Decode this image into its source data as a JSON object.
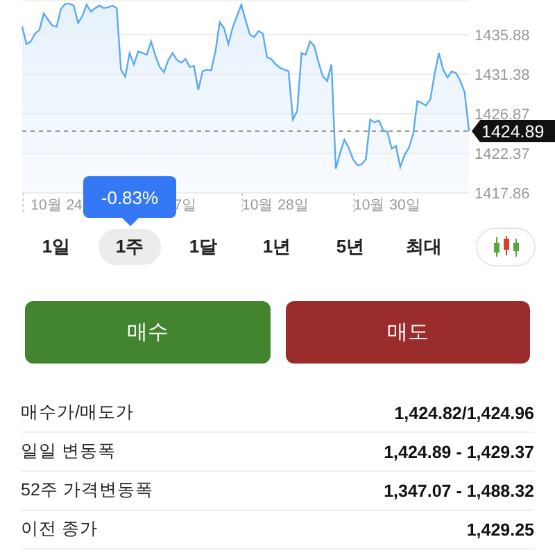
{
  "chart": {
    "chart_data": {
      "type": "area",
      "grid": true,
      "categories": [
        null,
        null,
        null,
        null,
        null,
        null,
        null,
        null,
        "10월 24",
        null,
        null,
        null,
        null,
        null,
        null,
        null,
        null,
        null,
        null,
        null,
        null,
        null,
        null,
        null,
        null,
        null,
        null,
        null,
        null,
        null,
        null,
        null,
        null,
        null,
        null,
        null,
        null,
        null,
        "7일",
        null,
        null,
        null,
        null,
        null,
        null,
        null,
        null,
        null,
        null,
        null,
        null,
        null,
        null,
        null,
        null,
        null,
        null,
        null,
        null,
        "10월 28일",
        null,
        null,
        null,
        null,
        null,
        null,
        null,
        null,
        null,
        null,
        null,
        null,
        null,
        null,
        null,
        null,
        null,
        null,
        null,
        null,
        null,
        null,
        null,
        null,
        null,
        "10월 30일",
        null,
        null,
        null,
        null,
        null,
        null,
        null,
        null,
        null,
        null,
        null,
        null,
        null,
        null,
        null,
        null,
        null,
        null,
        null
      ],
      "series": [
        {
          "color": "#5aa9f5",
          "values": [
            1436.8,
            1434.8,
            1435.1,
            1436.0,
            1436.4,
            1438.3,
            1437.6,
            1436.9,
            1436.8,
            1438.8,
            1439.4,
            1439.4,
            1439.2,
            1437.2,
            1438.0,
            1439.3,
            1438.5,
            1438.9,
            1439.2,
            1438.9,
            1439.0,
            1439.2,
            1438.9,
            1431.9,
            1431.1,
            1433.8,
            1432.5,
            1434.0,
            1433.8,
            1433.6,
            1435.1,
            1433.5,
            1432.2,
            1431.6,
            1433.0,
            1433.8,
            1433.0,
            1432.7,
            1433.1,
            1432.2,
            1432.3,
            1429.6,
            1431.7,
            1431.9,
            1431.8,
            1434.0,
            1437.3,
            1436.6,
            1434.8,
            1436.7,
            1438.0,
            1439.3,
            1437.5,
            1435.9,
            1435.6,
            1436.3,
            1436.0,
            1433.3,
            1433.1,
            1432.5,
            1432.1,
            1431.9,
            1431.7,
            1426.2,
            1427.2,
            1433.8,
            1433.6,
            1435.1,
            1434.6,
            1432.7,
            1431.1,
            1430.6,
            1432.5,
            1420.6,
            1422.4,
            1423.9,
            1423.0,
            1421.7,
            1421.0,
            1421.1,
            1421.7,
            1426.2,
            1425.9,
            1426.1,
            1425.0,
            1424.8,
            1422.9,
            1423.2,
            1420.8,
            1422.2,
            1423.0,
            1424.6,
            1428.3,
            1428.1,
            1427.8,
            1428.5,
            1431.4,
            1433.8,
            1431.9,
            1431.0,
            1431.7,
            1431.5,
            1430.6,
            1429.3,
            1424.9
          ]
        }
      ],
      "ylim": [
        1417.86,
        1439.83
      ],
      "yticks": [
        1417.86,
        1422.37,
        1426.87,
        1431.38,
        1435.88
      ],
      "ref_lines": [
        {
          "axis": "y",
          "value": 1424.89,
          "label": "1424.89"
        }
      ]
    }
  },
  "tooltip": {
    "text": "-0.83%"
  },
  "ranges": [
    {
      "label": "1일",
      "selected": false
    },
    {
      "label": "1주",
      "selected": true
    },
    {
      "label": "1달",
      "selected": false
    },
    {
      "label": "1년",
      "selected": false
    },
    {
      "label": "5년",
      "selected": false
    },
    {
      "label": "최대",
      "selected": false
    }
  ],
  "trade_buttons": [
    {
      "label": "매수",
      "kind": "buy"
    },
    {
      "label": "매도",
      "kind": "sell"
    }
  ],
  "stats": [
    {
      "label": "매수가/매도가",
      "value": "1,424.82/1,424.96"
    },
    {
      "label": "일일 변동폭",
      "value": "1,424.89 - 1,429.37"
    },
    {
      "label": "52주 가격변동폭",
      "value": "1,347.07 - 1,488.32"
    },
    {
      "label": "이전 종가",
      "value": "1,429.25"
    }
  ]
}
